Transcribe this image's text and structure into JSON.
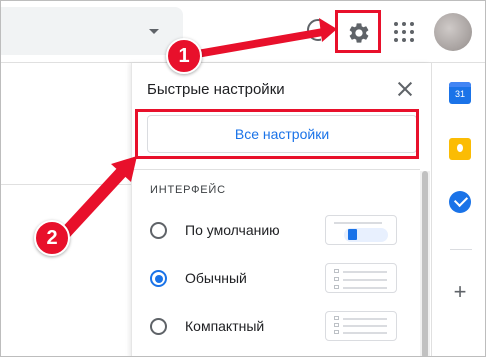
{
  "top_bar": {
    "icons": {
      "search_dropdown": "triangle-down-icon",
      "help": "help-circle-icon",
      "settings": "gear-icon",
      "apps": "apps-grid-icon",
      "avatar": "user-avatar"
    }
  },
  "quick_settings": {
    "title": "Быстрые настройки",
    "close_icon": "close-icon",
    "all_settings_label": "Все настройки",
    "section_label": "ИНТЕРФЕЙС",
    "options": [
      {
        "label": "По умолчанию",
        "selected": false
      },
      {
        "label": "Обычный",
        "selected": true
      },
      {
        "label": "Компактный",
        "selected": false
      }
    ]
  },
  "right_rail": {
    "calendar_text": "31",
    "icons": [
      "calendar-icon",
      "keep-icon",
      "tasks-icon",
      "add-icon"
    ]
  },
  "annotations": {
    "badge_1": "1",
    "badge_2": "2",
    "highlight_color": "#e8102b"
  },
  "colors": {
    "accent": "#1a73e8",
    "annotation_red": "#e8102b"
  }
}
